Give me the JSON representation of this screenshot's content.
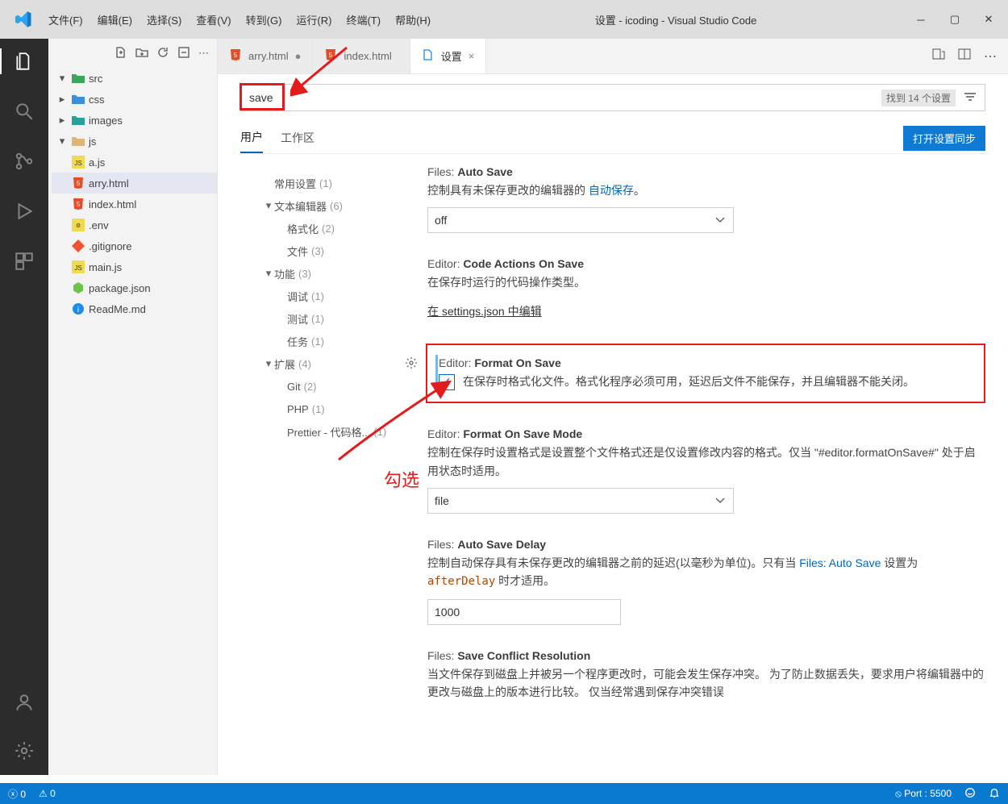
{
  "window": {
    "title": "设置 - icoding - Visual Studio Code"
  },
  "menus": [
    "文件(F)",
    "编辑(E)",
    "选择(S)",
    "查看(V)",
    "转到(G)",
    "运行(R)",
    "终端(T)",
    "帮助(H)"
  ],
  "sidebar": {
    "tree": [
      {
        "depth": 1,
        "chev": "▾",
        "icon": "folder-green",
        "label": "src"
      },
      {
        "depth": 2,
        "chev": "▸",
        "icon": "folder-blue",
        "label": "css"
      },
      {
        "depth": 2,
        "chev": "▸",
        "icon": "folder-teal",
        "label": "images"
      },
      {
        "depth": 2,
        "chev": "▾",
        "icon": "folder-yellow",
        "label": "js"
      },
      {
        "depth": 3,
        "chev": "",
        "icon": "js",
        "label": "a.js"
      },
      {
        "depth": 3,
        "chev": "",
        "icon": "html",
        "label": "arry.html",
        "selected": true
      },
      {
        "depth": 3,
        "chev": "",
        "icon": "html",
        "label": "index.html"
      },
      {
        "depth": 1,
        "chev": "",
        "icon": "env",
        "label": ".env"
      },
      {
        "depth": 1,
        "chev": "",
        "icon": "git",
        "label": ".gitignore"
      },
      {
        "depth": 1,
        "chev": "",
        "icon": "js",
        "label": "main.js"
      },
      {
        "depth": 1,
        "chev": "",
        "icon": "node",
        "label": "package.json"
      },
      {
        "depth": 1,
        "chev": "",
        "icon": "info",
        "label": "ReadMe.md"
      }
    ]
  },
  "tabs": [
    {
      "icon": "html",
      "label": "arry.html",
      "close": "●"
    },
    {
      "icon": "html",
      "label": "index.html",
      "close": ""
    },
    {
      "icon": "settings",
      "label": "设置",
      "close": "×",
      "active": true
    }
  ],
  "settings": {
    "search": {
      "value": "save",
      "count": "找到 14 个设置"
    },
    "scopes": {
      "user": "用户",
      "workspace": "工作区",
      "sync": "打开设置同步"
    },
    "toc": [
      {
        "lvl": "l1",
        "chev": "",
        "label": "常用设置",
        "cnt": "(1)"
      },
      {
        "lvl": "l1",
        "chev": "▾",
        "label": "文本编辑器",
        "cnt": "(6)"
      },
      {
        "lvl": "l2",
        "chev": "",
        "label": "格式化",
        "cnt": "(2)"
      },
      {
        "lvl": "l2",
        "chev": "",
        "label": "文件",
        "cnt": "(3)"
      },
      {
        "lvl": "l1",
        "chev": "▾",
        "label": "功能",
        "cnt": "(3)"
      },
      {
        "lvl": "l2",
        "chev": "",
        "label": "调试",
        "cnt": "(1)"
      },
      {
        "lvl": "l2",
        "chev": "",
        "label": "测试",
        "cnt": "(1)"
      },
      {
        "lvl": "l2",
        "chev": "",
        "label": "任务",
        "cnt": "(1)"
      },
      {
        "lvl": "l1",
        "chev": "▾",
        "label": "扩展",
        "cnt": "(4)"
      },
      {
        "lvl": "l2",
        "chev": "",
        "label": "Git",
        "cnt": "(2)"
      },
      {
        "lvl": "l2",
        "chev": "",
        "label": "PHP",
        "cnt": "(1)"
      },
      {
        "lvl": "l2",
        "chev": "",
        "label": "Prettier - 代码格...",
        "cnt": "(1)"
      }
    ],
    "items": {
      "autoSave": {
        "prefix": "Files:",
        "key": "Auto Save",
        "desc_a": "控制具有未保存更改的编辑器的 ",
        "desc_link": "自动保存",
        "desc_b": "。",
        "value": "off"
      },
      "codeActions": {
        "prefix": "Editor:",
        "key": "Code Actions On Save",
        "desc": "在保存时运行的代码操作类型。",
        "link": "在 settings.json 中编辑"
      },
      "formatOnSave": {
        "prefix": "Editor:",
        "key": "Format On Save",
        "desc": "在保存时格式化文件。格式化程序必须可用，延迟后文件不能保存，并且编辑器不能关闭。"
      },
      "formatMode": {
        "prefix": "Editor:",
        "key": "Format On Save Mode",
        "desc": "控制在保存时设置格式是设置整个文件格式还是仅设置修改内容的格式。仅当 \"#editor.formatOnSave#\" 处于启用状态时适用。",
        "value": "file"
      },
      "autoSaveDelay": {
        "prefix": "Files:",
        "key": "Auto Save Delay",
        "desc_a": "控制自动保存具有未保存更改的编辑器之前的延迟(以毫秒为单位)。只有当 ",
        "desc_link": "Files: Auto Save",
        "desc_b": " 设置为 ",
        "desc_code": "afterDelay",
        "desc_c": " 时才适用。",
        "value": "1000"
      },
      "conflict": {
        "prefix": "Files:",
        "key": "Save Conflict Resolution",
        "desc": "当文件保存到磁盘上并被另一个程序更改时，可能会发生保存冲突。 为了防止数据丢失，要求用户将编辑器中的更改与磁盘上的版本进行比较。 仅当经常遇到保存冲突错误"
      }
    }
  },
  "statusbar": {
    "errors": "0",
    "warnings": "0",
    "port": "Port : 5500"
  },
  "annotation": {
    "check_label": "勾选"
  }
}
